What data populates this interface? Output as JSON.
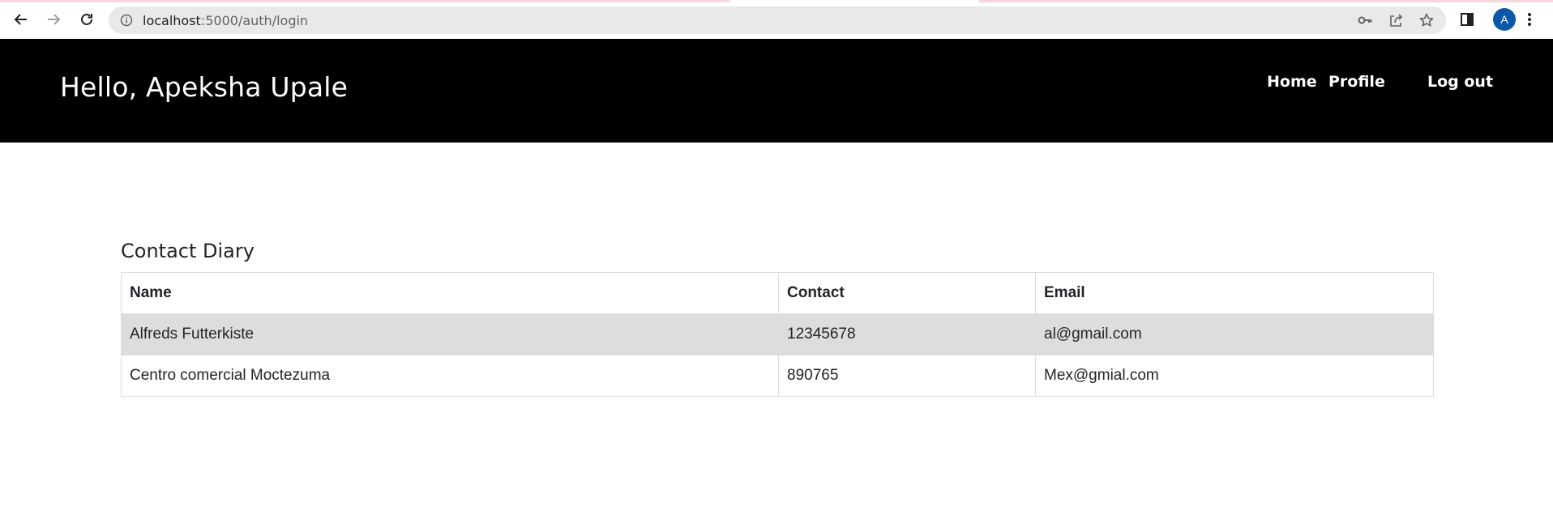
{
  "browser": {
    "url_host": "localhost",
    "url_path": ":5000/auth/login",
    "profile_initial": "A",
    "icons": [
      "back-arrow-icon",
      "forward-arrow-icon",
      "reload-icon",
      "info-icon",
      "key-icon",
      "share-icon",
      "star-icon",
      "side-panel-icon",
      "kebab-menu-icon"
    ]
  },
  "header": {
    "greeting": "Hello, Apeksha Upale",
    "nav": {
      "home": "Home",
      "profile": "Profile",
      "logout": "Log out"
    }
  },
  "main": {
    "title": "Contact Diary",
    "table": {
      "columns": [
        "Name",
        "Contact",
        "Email"
      ],
      "rows": [
        {
          "name": "Alfreds Futterkiste",
          "contact": "12345678",
          "email": "al@gmail.com"
        },
        {
          "name": "Centro comercial Moctezuma",
          "contact": "890765",
          "email": "Mex@gmial.com"
        }
      ]
    }
  },
  "colors": {
    "header_bg": "#000000",
    "striped_row": "#dddddd",
    "avatar": "#0b57a8",
    "omnibox": "#e9e9e9"
  }
}
